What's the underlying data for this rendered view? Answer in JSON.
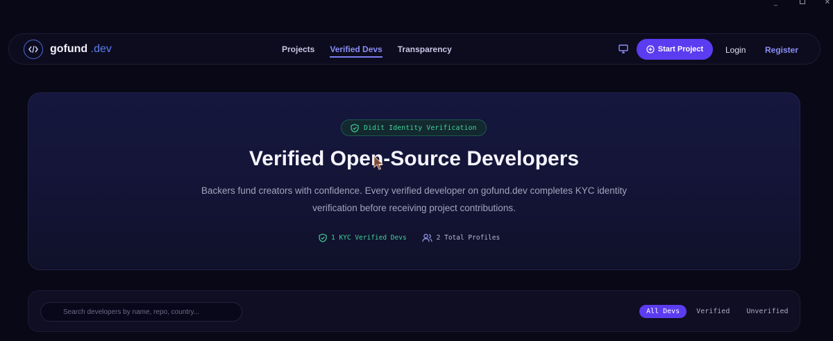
{
  "brand": {
    "name": "gofund",
    "suffix": ".dev",
    "accent": "#5b3cf0",
    "link_color": "#8b8ff6",
    "success_color": "#3fd39b",
    "icon": "code-icon"
  },
  "nav": {
    "items": [
      {
        "label": "Projects",
        "active": false
      },
      {
        "label": "Verified Devs",
        "active": true
      },
      {
        "label": "Transparency",
        "active": false
      }
    ],
    "start_project_label": "Start Project",
    "login_label": "Login",
    "register_label": "Register"
  },
  "hero": {
    "badge_label": "Didit Identity Verification",
    "title": "Verified Open-Source Developers",
    "description": "Backers fund creators with confidence. Every verified developer on gofund.dev completes KYC identity verification before receiving project contributions.",
    "stats": {
      "verified": "1 KYC Verified Devs",
      "total": "2 Total Profiles"
    }
  },
  "filters": {
    "search_placeholder": "Search developers by name, repo, country...",
    "tabs": [
      {
        "label": "All Devs",
        "active": true
      },
      {
        "label": "Verified",
        "active": false
      },
      {
        "label": "Unverified",
        "active": false
      }
    ]
  }
}
